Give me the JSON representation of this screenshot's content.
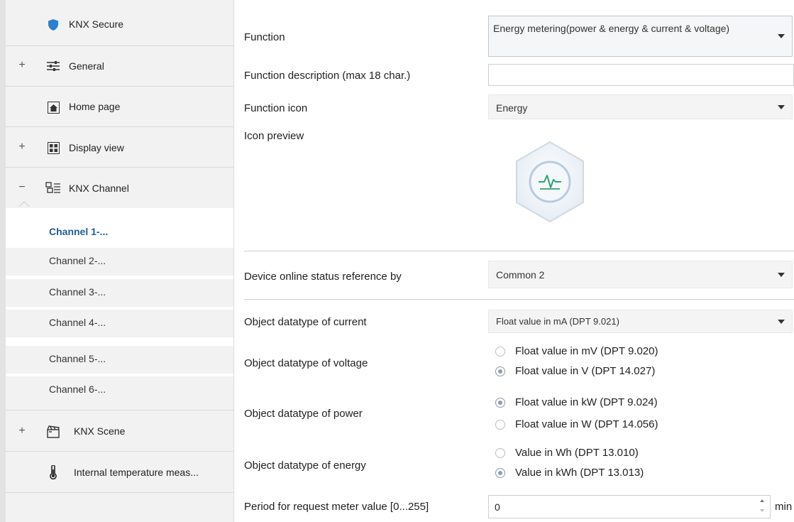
{
  "sidebar": {
    "items": [
      {
        "label": "KNX Secure",
        "expander": "",
        "icon": "shield-icon"
      },
      {
        "label": "General",
        "expander": "+",
        "icon": "sliders-icon"
      },
      {
        "label": "Home page",
        "expander": "",
        "icon": "home-icon"
      },
      {
        "label": "Display view",
        "expander": "+",
        "icon": "display-grid-icon"
      },
      {
        "label": "KNX Channel",
        "expander": "−",
        "icon": "channel-icon"
      },
      {
        "label": "KNX Scene",
        "expander": "+",
        "icon": "scene-icon"
      },
      {
        "label": "Internal temperature meas...",
        "expander": "",
        "icon": "thermometer-icon"
      }
    ],
    "channels": [
      "Channel 1-...",
      "Channel 2-...",
      "Channel 3-...",
      "Channel 4-...",
      "Channel 5-...",
      "Channel 6-..."
    ],
    "active_channel_index": 0
  },
  "params": {
    "function": {
      "label": "Function",
      "value": "Energy metering(power & energy & current & voltage)"
    },
    "function_description": {
      "label": "Function description (max 18 char.)",
      "value": ""
    },
    "function_icon": {
      "label": "Function icon",
      "value": "Energy"
    },
    "icon_preview": {
      "label": "Icon preview",
      "icon": "energy-pulse-icon"
    },
    "online_status": {
      "label": "Device online status reference by",
      "value": "Common 2"
    },
    "current_type": {
      "label": "Object datatype of current",
      "value": "Float value in mA (DPT 9.021)"
    },
    "voltage_type": {
      "label": "Object datatype of voltage",
      "options": [
        "Float value in mV (DPT 9.020)",
        "Float value in V (DPT 14.027)"
      ],
      "selected": 1
    },
    "power_type": {
      "label": "Object datatype of power",
      "options": [
        "Float value in kW (DPT 9.024)",
        "Float value in W (DPT 14.056)"
      ],
      "selected": 0
    },
    "energy_type": {
      "label": "Object datatype of energy",
      "options": [
        "Value in Wh (DPT 13.010)",
        "Value in kWh (DPT 13.013)"
      ],
      "selected": 1
    },
    "request_period": {
      "label": "Period for request meter value [0...255]",
      "value": "0",
      "unit": "min"
    }
  },
  "colors": {
    "active_channel": "#1f5e9c",
    "sidebar_bg": "#f2f2f2",
    "icon_accent": "#2fa36b"
  }
}
